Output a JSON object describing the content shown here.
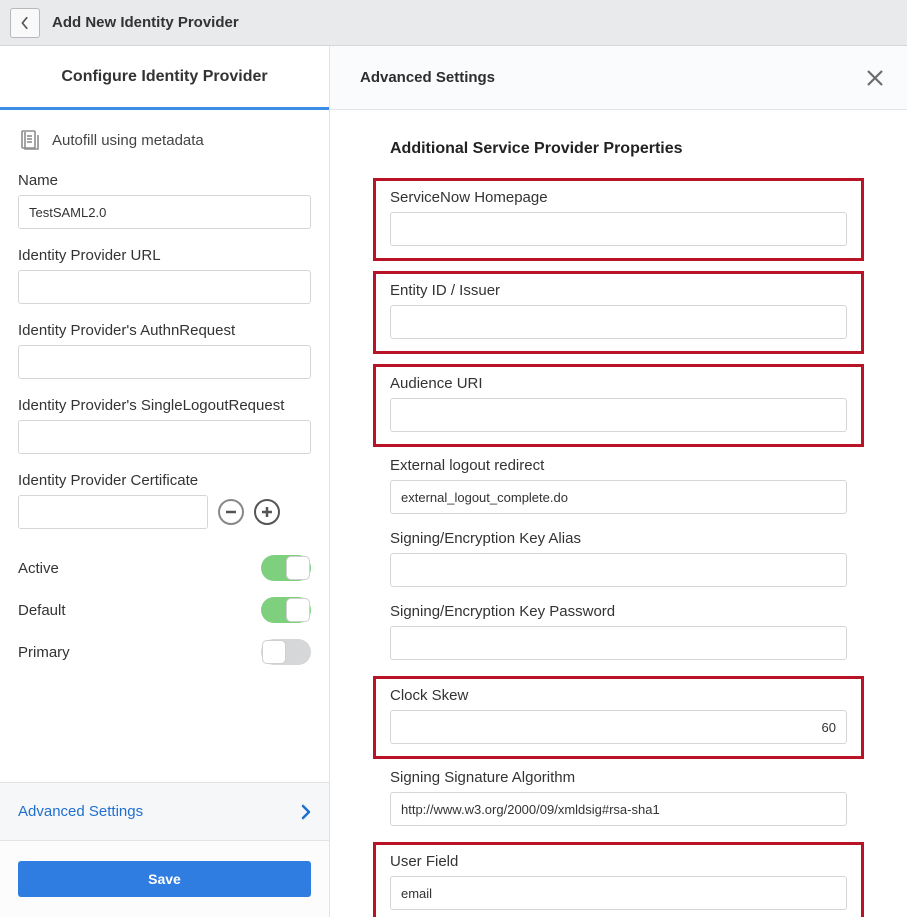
{
  "top": {
    "title": "Add New Identity Provider"
  },
  "left": {
    "title": "Configure Identity Provider",
    "autofill": "Autofill using metadata",
    "fields": {
      "name_label": "Name",
      "name_value": "TestSAML2.0",
      "idp_url_label": "Identity Provider URL",
      "idp_url_value": "",
      "authn_label": "Identity Provider's AuthnRequest",
      "authn_value": "",
      "slo_label": "Identity Provider's SingleLogoutRequest",
      "slo_value": "",
      "cert_label": "Identity Provider Certificate",
      "cert_value": ""
    },
    "toggles": {
      "active_label": "Active",
      "active_on": true,
      "default_label": "Default",
      "default_on": true,
      "primary_label": "Primary",
      "primary_on": false
    },
    "advanced_label": "Advanced Settings",
    "save_label": "Save"
  },
  "right": {
    "title": "Advanced Settings",
    "section_title": "Additional Service Provider Properties",
    "fields": {
      "homepage_label": "ServiceNow Homepage",
      "homepage_value": "",
      "entity_label": "Entity ID / Issuer",
      "entity_value": "",
      "audience_label": "Audience URI",
      "audience_value": "",
      "ext_logout_label": "External logout redirect",
      "ext_logout_value": "external_logout_complete.do",
      "key_alias_label": "Signing/Encryption Key Alias",
      "key_alias_value": "",
      "key_pw_label": "Signing/Encryption Key Password",
      "key_pw_value": "",
      "clock_label": "Clock Skew",
      "clock_value": "60",
      "sig_alg_label": "Signing Signature Algorithm",
      "sig_alg_value": "http://www.w3.org/2000/09/xmldsig#rsa-sha1",
      "user_field_label": "User Field",
      "user_field_value": "email"
    }
  }
}
